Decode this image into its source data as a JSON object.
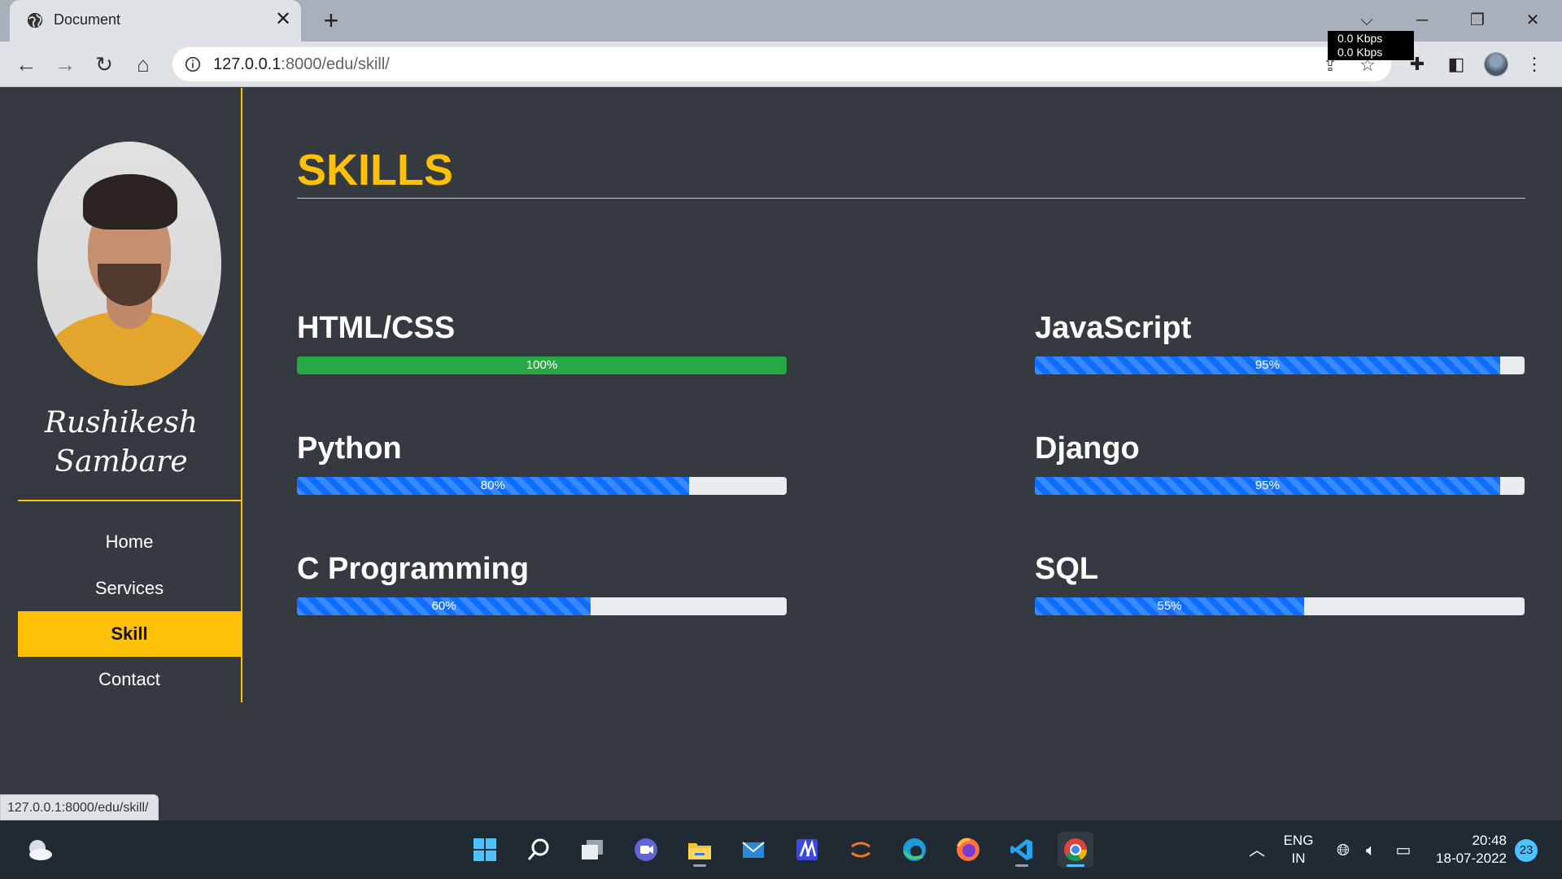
{
  "browser": {
    "tab_title": "Document",
    "tab_close": "✕",
    "new_tab": "+",
    "url_host": "127.0.0.1",
    "url_path": ":8000/edu/skill/",
    "net_up": "0.0 Kbps",
    "net_down": "0.0 Kbps",
    "status_url": "127.0.0.1:8000/edu/skill/"
  },
  "sidebar": {
    "name_line1": "Rushikesh",
    "name_line2": "Sambare",
    "nav": [
      {
        "label": "Home"
      },
      {
        "label": "Services"
      },
      {
        "label": "Skill",
        "active": true
      },
      {
        "label": "Contact"
      }
    ]
  },
  "main": {
    "heading": "SKILLS",
    "skills": [
      {
        "name": "HTML/CSS",
        "percent": 100,
        "label": "100%",
        "style": "solid"
      },
      {
        "name": "JavaScript",
        "percent": 95,
        "label": "95%",
        "style": "striped"
      },
      {
        "name": "Python",
        "percent": 80,
        "label": "80%",
        "style": "striped"
      },
      {
        "name": "Django",
        "percent": 95,
        "label": "95%",
        "style": "striped"
      },
      {
        "name": "C Programming",
        "percent": 60,
        "label": "60%",
        "style": "striped"
      },
      {
        "name": "SQL",
        "percent": 55,
        "label": "55%",
        "style": "striped"
      }
    ]
  },
  "taskbar": {
    "lang_line1": "ENG",
    "lang_line2": "IN",
    "time": "20:48",
    "date": "18-07-2022",
    "notifications": "23"
  },
  "colors": {
    "accent": "#ffc107",
    "background": "#343a40",
    "bar_blue": "#0d6efd",
    "bar_green": "#28a745"
  }
}
